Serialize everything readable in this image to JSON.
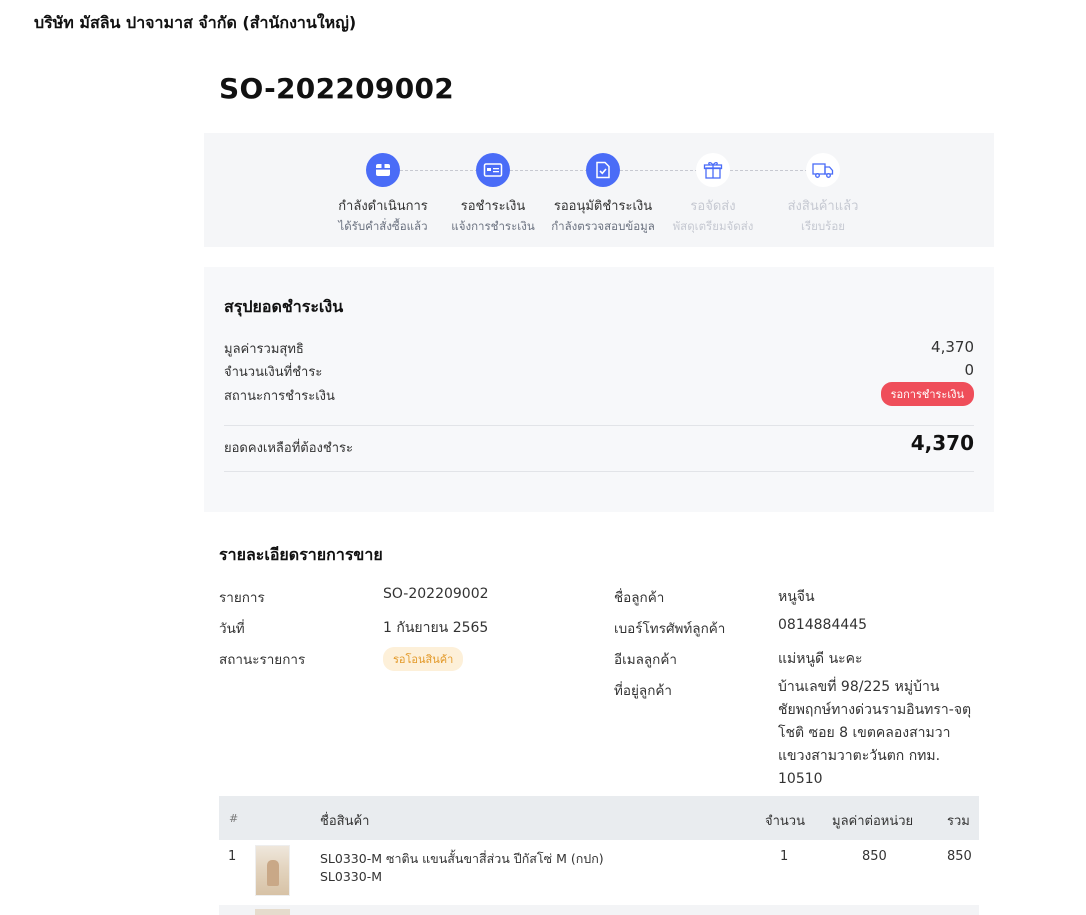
{
  "company": "บริษัท มัสลิน ปาจามาส จำกัด (สำนักงานใหญ่)",
  "order_no": "SO-202209002",
  "colors": {
    "accent": "#4a6cf7",
    "danger": "#ef4e5a",
    "warning_bg": "#fdf0d9",
    "warning_text": "#e39a2a"
  },
  "steps": [
    {
      "title": "กำลังดำเนินการ",
      "sub": "ได้รับคำสั่งซื้อแล้ว",
      "icon": "box-icon",
      "active": true
    },
    {
      "title": "รอชำระเงิน",
      "sub": "แจ้งการชำระเงิน",
      "icon": "payment-card-icon",
      "active": true
    },
    {
      "title": "รออนุมัติชำระเงิน",
      "sub": "กำลังตรวจสอบข้อมูล",
      "icon": "document-check-icon",
      "active": true
    },
    {
      "title": "รอจัดส่ง",
      "sub": "พัสดุเตรียมจัดส่ง",
      "icon": "gift-box-icon",
      "active": false
    },
    {
      "title": "ส่งสินค้าแล้ว",
      "sub": "เรียบร้อย",
      "icon": "truck-icon",
      "active": false
    }
  ],
  "summary": {
    "title": "สรุปยอดชำระเงิน",
    "net_label": "มูลค่ารวมสุทธิ",
    "net_value": "4,370",
    "paid_label": "จำนวนเงินที่ชำระ",
    "paid_value": "0",
    "status_label": "สถานะการชำระเงิน",
    "status_badge": "รอการชำระเงิน",
    "balance_label": "ยอดคงเหลือที่ต้องชำระ",
    "balance_value": "4,370"
  },
  "detail": {
    "title": "รายละเอียดรายการขาย",
    "item_label": "รายการ",
    "item_value": "SO-202209002",
    "date_label": "วันที่",
    "date_value": "1 กันยายน 2565",
    "status_label": "สถานะรายการ",
    "status_badge": "รอโอนสินค้า",
    "customer_label": "ชื่อลูกค้า",
    "customer_value": "หนูจีน",
    "phone_label": "เบอร์โทรศัพท์ลูกค้า",
    "phone_value": "0814884445",
    "email_label": "อีเมลลูกค้า",
    "email_value": "แม่หนูดี นะคะ",
    "address_label": "ที่อยู่ลูกค้า",
    "address_value": "บ้านเลขที่ 98/225 หมู่บ้านชัยพฤกษ์ทางด่วนรามอินทรา-จตุโชติ ซอย 8 เขตคลองสามวา แขวงสามวาตะวันตก กทม. 10510"
  },
  "table": {
    "headers": {
      "index": "#",
      "name": "ชื่อสินค้า",
      "qty": "จำนวน",
      "unit_price": "มูลค่าต่อหน่วย",
      "total": "รวม"
    },
    "rows": [
      {
        "index": "1",
        "name": "SL0330-M ซาติน แขนสั้นขาสี่ส่วน ปีกัสโซ่ M (กปก)",
        "sku": "SL0330-M",
        "qty": "1",
        "unit_price": "850",
        "total": "850"
      }
    ]
  }
}
